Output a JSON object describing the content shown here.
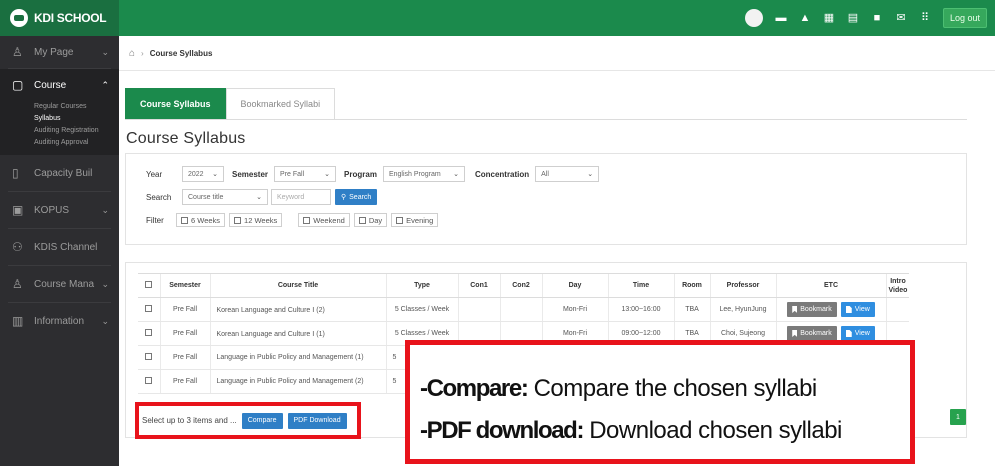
{
  "header": {
    "logo_text": "KDI SCHOOL",
    "logout_label": "Log out",
    "icons": [
      "user-avatar",
      "document-icon",
      "bell-icon",
      "calendar-icon",
      "grid-icon",
      "video-icon",
      "mail-icon",
      "apps-icon"
    ]
  },
  "sidebar": {
    "items": [
      {
        "label": "My Page",
        "icon": "user-icon"
      },
      {
        "label": "Course",
        "icon": "course-icon"
      },
      {
        "label": "Capacity Buil",
        "icon": "book-icon"
      },
      {
        "label": "KOPUS",
        "icon": "kopus-icon"
      },
      {
        "label": "KDIS Channel",
        "icon": "people-icon"
      },
      {
        "label": "Course Mana",
        "icon": "user-icon"
      },
      {
        "label": "Information",
        "icon": "info-icon"
      }
    ],
    "course_subitems": [
      "Regular Courses",
      "Syllabus",
      "Auditing Registration",
      "Auditing Approval"
    ]
  },
  "breadcrumb": {
    "current": "Course Syllabus"
  },
  "tabs": [
    {
      "label": "Course Syllabus"
    },
    {
      "label": "Bookmarked Syllabi"
    }
  ],
  "page_title": "Course Syllabus",
  "filters": {
    "year_label": "Year",
    "year_value": "2022",
    "semester_label": "Semester",
    "semester_value": "Pre Fall",
    "program_label": "Program",
    "program_value": "English Program",
    "concentration_label": "Concentration",
    "concentration_value": "All",
    "search_label": "Search",
    "search_field_value": "Course title",
    "keyword_placeholder": "Keyword",
    "search_button": "Search",
    "filter_label": "Filter",
    "checkboxes": [
      "6 Weeks",
      "12 Weeks",
      "Weekend",
      "Day",
      "Evening"
    ]
  },
  "table": {
    "headers": [
      "",
      "Semester",
      "Course Title",
      "Type",
      "Con1",
      "Con2",
      "Day",
      "Time",
      "Room",
      "Professor",
      "ETC",
      "Intro Video"
    ],
    "rows": [
      {
        "semester": "Pre Fall",
        "title": "Korean Language and Culture Ⅰ (2)",
        "type": "5 Classes / Week",
        "con1": "",
        "con2": "",
        "day": "Mon-Fri",
        "time": "13:00~16:00",
        "room": "TBA",
        "professor": "Lee, HyunJung"
      },
      {
        "semester": "Pre Fall",
        "title": "Korean Language and Culture Ⅰ (1)",
        "type": "5 Classes / Week",
        "con1": "",
        "con2": "",
        "day": "Mon-Fri",
        "time": "09:00~12:00",
        "room": "TBA",
        "professor": "Choi, Sujeong"
      },
      {
        "semester": "Pre Fall",
        "title": "Language in Public Policy and Management (1)",
        "type": "5",
        "con1": "",
        "con2": "",
        "day": "",
        "time": "",
        "room": "",
        "professor": ""
      },
      {
        "semester": "Pre Fall",
        "title": "Language in Public Policy and Management (2)",
        "type": "5",
        "con1": "",
        "con2": "",
        "day": "",
        "time": "",
        "room": "",
        "professor": ""
      }
    ],
    "bookmark_label": "Bookmark",
    "view_label": "View"
  },
  "pagination": {
    "current_page": "1"
  },
  "actions": {
    "select_text": "Select up to 3 items and ...",
    "compare_label": "Compare",
    "pdf_label": "PDF Download"
  },
  "callout": {
    "line1_term": "-Compare:",
    "line1_desc": " Compare the chosen syllabi",
    "line2_term": "-PDF download:",
    "line2_desc": " Download chosen syllabi"
  },
  "colors": {
    "header_green": "#1b8a4c",
    "sidebar_dark": "#2d2d30",
    "accent_blue": "#2f7fc6",
    "highlight_red": "#e8131b"
  }
}
